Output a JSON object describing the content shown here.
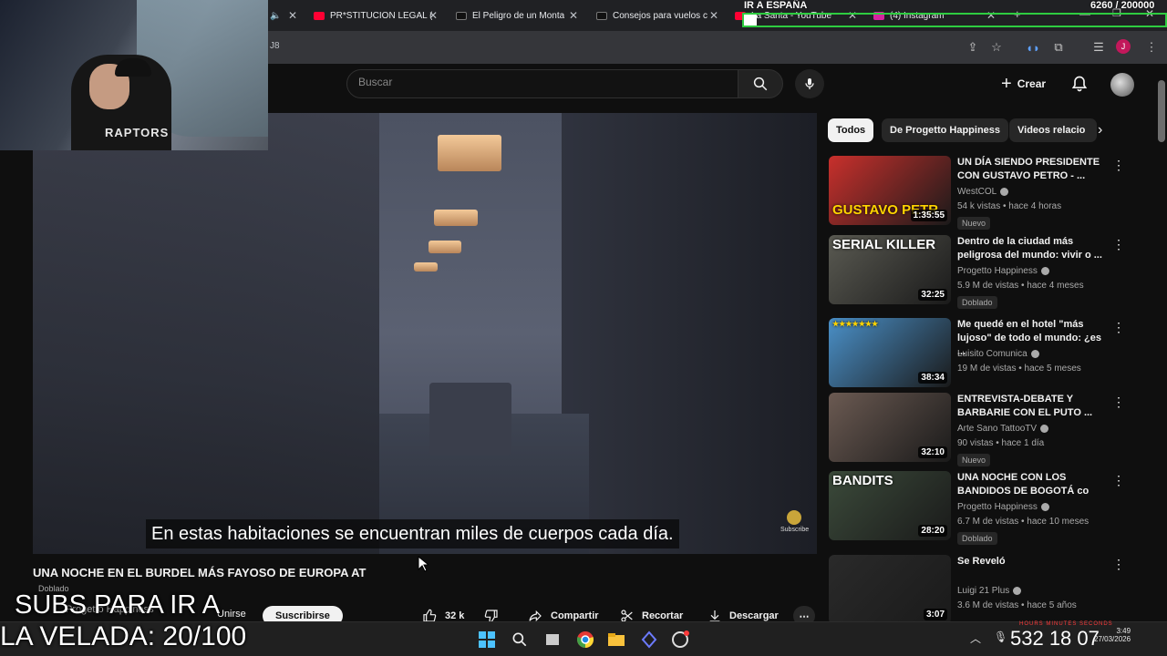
{
  "browser": {
    "tabs": [
      {
        "label": "PR*STITUCION LEGAL ("
      },
      {
        "label": "El Peligro de un Monta"
      },
      {
        "label": "Consejos para vuelos c"
      },
      {
        "label": "La Santa - YouTube"
      },
      {
        "label": "(4) Instagram"
      }
    ],
    "url_fragment": "J8"
  },
  "stream_overlay": {
    "goal_title": "IR A ESPAÑA",
    "goal_count": "6260 / 200000",
    "goal_progress": 0.0313,
    "subs_line": "SUBS PARA IR A",
    "velada_line": "LA VELADA: 20/100",
    "shirt_text": "RAPTORS",
    "timer_labels": "HOURS  MINUTES  SECONDS",
    "timer_value": "532 18 07",
    "colors": {
      "goal_border": "#2ecc40"
    }
  },
  "youtube": {
    "search_placeholder": "Buscar",
    "create_label": "Crear",
    "subtitle": "En estas habitaciones se encuentran miles de cuerpos cada día.",
    "watermark_label": "Subscribe",
    "video_title": "UNA NOCHE EN EL BURDEL MÁS FAYOSO DE EUROPA AT",
    "dub_label": "Doblado",
    "channel_name": "Progetto Happiness",
    "join_label": "Unirse",
    "subscribe_label": "Suscribirse",
    "like_count": "32 k",
    "share_label": "Compartir",
    "clip_label": "Recortar",
    "download_label": "Descargar"
  },
  "chips": [
    {
      "label": "Todos",
      "active": true
    },
    {
      "label": "De Progetto Happiness",
      "active": false
    },
    {
      "label": "Videos relacio",
      "active": false
    }
  ],
  "recommendations": [
    {
      "title": "UN DÍA SIENDO PRESIDENTE CON GUSTAVO PETRO - ...",
      "channel": "WestCOL",
      "meta": "54 k vistas • hace 4 horas",
      "badge": "Nuevo",
      "duration": "1:35:55",
      "thumb_text": "GUSTAVO PETR",
      "thumb_color": "#c9302c"
    },
    {
      "title": "Dentro de la ciudad más peligrosa del mundo: vivir o ...",
      "channel": "Progetto Happiness",
      "meta": "5.9 M de vistas • hace 4 meses",
      "badge": "Doblado",
      "duration": "32:25",
      "thumb_text": "SERIAL KILLER",
      "thumb_color": "#5a5a52"
    },
    {
      "title": "Me quedé en el hotel \"más lujoso\" de todo el mundo: ¿es ...",
      "channel": "Luisito Comunica",
      "meta": "19 M de vistas • hace 5 meses",
      "badge": "",
      "duration": "38:34",
      "thumb_text": "★★★★★★★",
      "thumb_color": "#4a90c8"
    },
    {
      "title": "ENTREVISTA-DEBATE Y BARBARIE CON EL PUTO ...",
      "channel": "Arte Sano TattooTV",
      "meta": "90 vistas • hace 1 día",
      "badge": "Nuevo",
      "duration": "32:10",
      "thumb_text": "",
      "thumb_color": "#6b5a52"
    },
    {
      "title": "UNA NOCHE CON LOS BANDIDOS DE BOGOTÁ co",
      "channel": "Progetto Happiness",
      "meta": "6.7 M de vistas • hace 10 meses",
      "badge": "Doblado",
      "duration": "28:20",
      "thumb_text": "BANDITS",
      "thumb_color": "#3b4a3a"
    },
    {
      "title": "Se Reveló",
      "channel": "Luigi 21 Plus",
      "meta": "3.6 M de vistas • hace 5 años",
      "badge": "",
      "duration": "3:07",
      "thumb_text": "",
      "thumb_color": "#2a2a2a"
    }
  ],
  "taskbar": {
    "clock_time": "3:49",
    "clock_date": "27/03/2026"
  }
}
